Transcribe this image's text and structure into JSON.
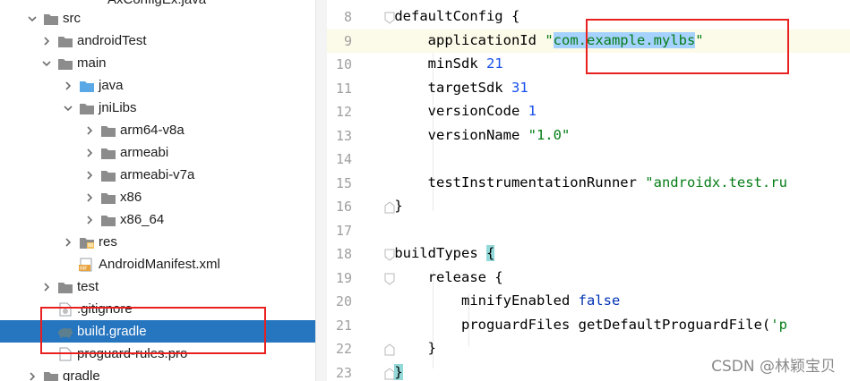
{
  "tree": {
    "top_partial_file": "AxConfigEx.java",
    "items": [
      {
        "label": "src",
        "indent": 1,
        "chevron": "down",
        "icon": "folder"
      },
      {
        "label": "androidTest",
        "indent": 2,
        "chevron": "right",
        "icon": "folder"
      },
      {
        "label": "main",
        "indent": 2,
        "chevron": "down",
        "icon": "folder"
      },
      {
        "label": "java",
        "indent": 3,
        "chevron": "right",
        "icon": "folder-blue"
      },
      {
        "label": "jniLibs",
        "indent": 3,
        "chevron": "down",
        "icon": "folder"
      },
      {
        "label": "arm64-v8a",
        "indent": 4,
        "chevron": "right",
        "icon": "folder"
      },
      {
        "label": "armeabi",
        "indent": 4,
        "chevron": "right",
        "icon": "folder"
      },
      {
        "label": "armeabi-v7a",
        "indent": 4,
        "chevron": "right",
        "icon": "folder"
      },
      {
        "label": "x86",
        "indent": 4,
        "chevron": "right",
        "icon": "folder"
      },
      {
        "label": "x86_64",
        "indent": 4,
        "chevron": "right",
        "icon": "folder"
      },
      {
        "label": "res",
        "indent": 3,
        "chevron": "right",
        "icon": "folder-res"
      },
      {
        "label": "AndroidManifest.xml",
        "indent": 3,
        "chevron": "none",
        "icon": "manifest"
      },
      {
        "label": "test",
        "indent": 2,
        "chevron": "right",
        "icon": "folder"
      },
      {
        "label": ".gitignore",
        "indent": 2,
        "chevron": "none",
        "icon": "gitignore"
      },
      {
        "label": "build.gradle",
        "indent": 2,
        "chevron": "none",
        "icon": "gradle",
        "selected": true
      },
      {
        "label": "proguard-rules.pro",
        "indent": 2,
        "chevron": "none",
        "icon": "file"
      },
      {
        "label": "gradle",
        "indent": 1,
        "chevron": "right",
        "icon": "folder"
      }
    ]
  },
  "editor": {
    "lines": [
      {
        "num": "8",
        "code": "    defaultConfig {",
        "fold": "open"
      },
      {
        "num": "9",
        "code": "        applicationId \"com.example.mylbs\"",
        "current": true
      },
      {
        "num": "10",
        "code": "        minSdk 21"
      },
      {
        "num": "11",
        "code": "        targetSdk 31"
      },
      {
        "num": "12",
        "code": "        versionCode 1"
      },
      {
        "num": "13",
        "code": "        versionName \"1.0\""
      },
      {
        "num": "14",
        "code": ""
      },
      {
        "num": "15",
        "code": "        testInstrumentationRunner \"androidx.test.ru"
      },
      {
        "num": "16",
        "code": "    }",
        "fold": "close"
      },
      {
        "num": "17",
        "code": ""
      },
      {
        "num": "18",
        "code": "    buildTypes {",
        "fold": "open"
      },
      {
        "num": "19",
        "code": "        release {",
        "fold": "open"
      },
      {
        "num": "20",
        "code": "            minifyEnabled false"
      },
      {
        "num": "21",
        "code": "            proguardFiles getDefaultProguardFile('p"
      },
      {
        "num": "22",
        "code": "        }",
        "fold": "close"
      },
      {
        "num": "23",
        "code": "    }",
        "fold": "close"
      }
    ]
  },
  "watermark": "CSDN @林颖宝贝",
  "colors": {
    "selection_row": "#2675bf",
    "annotation_red": "#e8201f",
    "string_green": "#067d17",
    "number_blue": "#1750eb",
    "keyword_blue": "#0033b3"
  }
}
